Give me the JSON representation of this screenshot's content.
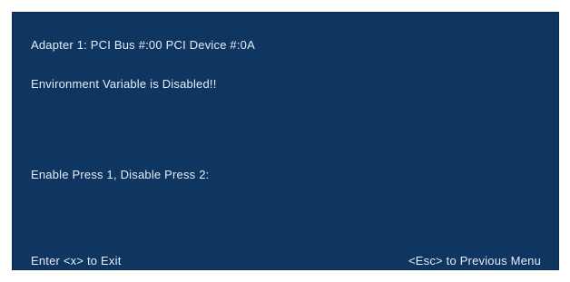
{
  "bios": {
    "adapter_line": "Adapter 1: PCI Bus #:00 PCI Device #:0A",
    "status_line": "Environment Variable is Disabled!!",
    "prompt_line": "Enable Press 1,  Disable Press 2:",
    "footer": {
      "exit_hint": "Enter <x> to Exit",
      "back_hint": "<Esc> to Previous Menu"
    }
  },
  "colors": {
    "background": "#0f3561",
    "text": "#e6ecf5"
  }
}
